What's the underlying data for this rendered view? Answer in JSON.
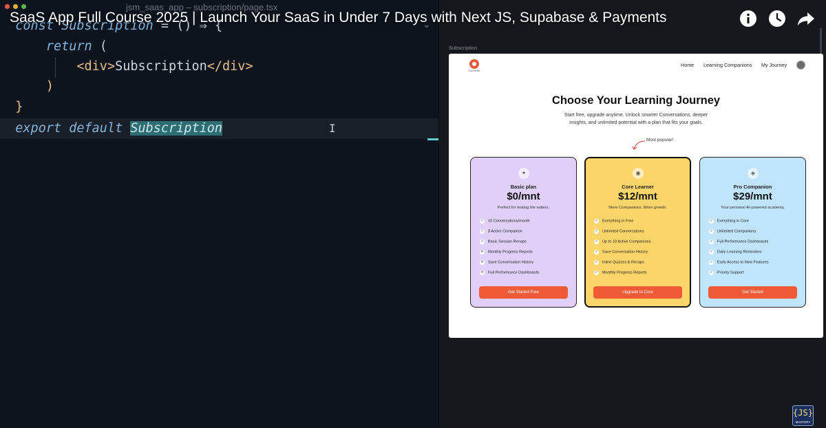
{
  "video": {
    "title": "SaaS App Full Course 2025 | Launch Your SaaS in Under 7 Days with Next JS, Supabase & Payments",
    "icons": [
      "info-icon",
      "watch-later-icon",
      "share-icon"
    ],
    "channel_badge": "{JS}",
    "channel_badge_sub": "MASTERY"
  },
  "editor": {
    "window_title": "jsm_saas_app – subscription/page.tsx",
    "lines": {
      "l1_kw": "const",
      "l1_name": " Subscription",
      "l1_rest": " = () ⇒ {",
      "l2_kw": "return",
      "l2_rest": " (",
      "l3_open": "<div>",
      "l3_text": "Subscription",
      "l3_close": "</div>",
      "l4": ")",
      "l5": "}",
      "l6_kw": "export default",
      "l6_name": "Subscription"
    }
  },
  "preview": {
    "panel_label": "Subscription",
    "logo_text": "Converso",
    "nav": [
      "Home",
      "Learning Companions",
      "My Journey"
    ],
    "heading": "Choose Your Learning Journey",
    "subheading_1": "Start free, upgrade anytime. Unlock smarter Conversations, deeper",
    "subheading_2": "insights, and unlimited potential with a plan that fits your goals.",
    "popular_label": "Most popular!",
    "plans": [
      {
        "icon": "sparkle-icon",
        "name": "Basic plan",
        "price": "$0/mnt",
        "desc": "Perfect for testing the waters.",
        "features": [
          {
            "text": "10 Conversations/month",
            "included": true
          },
          {
            "text": "3 Active Companion",
            "included": true
          },
          {
            "text": "Basic Session Recaps",
            "included": true
          },
          {
            "text": "Monthly Progress Reports",
            "included": false
          },
          {
            "text": "Save Conversation History",
            "included": false
          },
          {
            "text": "Full Performance Dashboards",
            "included": false
          }
        ],
        "cta": "Get Started Free",
        "color": "#dfcff9"
      },
      {
        "icon": "eye-icon",
        "name": "Core Learner",
        "price": "$12/mnt",
        "desc": "More Companions. More growth.",
        "features": [
          {
            "text": "Everything in Free",
            "included": true
          },
          {
            "text": "Unlimited Conversations",
            "included": true
          },
          {
            "text": "Up to 10 Active Companions",
            "included": true
          },
          {
            "text": "Save Conversation History",
            "included": true
          },
          {
            "text": "Inline Quizzes & Recaps",
            "included": true
          },
          {
            "text": "Monthly Progress Reports",
            "included": true
          }
        ],
        "cta": "Upgrade to Core",
        "color": "#fcd56a"
      },
      {
        "icon": "layers-icon",
        "name": "Pro Companion",
        "price": "$29/mnt",
        "desc": "Your personal AI-powered academy.",
        "features": [
          {
            "text": "Everything in Core",
            "included": true
          },
          {
            "text": "Unlimited Companions",
            "included": true
          },
          {
            "text": "Full Performance Dashboards",
            "included": true
          },
          {
            "text": "Daily Learning Reminders",
            "included": true
          },
          {
            "text": "Early Access to New Features",
            "included": true
          },
          {
            "text": "Priority Support",
            "included": true
          }
        ],
        "cta": "Get Started",
        "color": "#bfe4fb"
      }
    ]
  },
  "colors": {
    "accent_cta": "#f05a36",
    "editor_bg": "#0e141d",
    "selection": "#2e6e73"
  }
}
